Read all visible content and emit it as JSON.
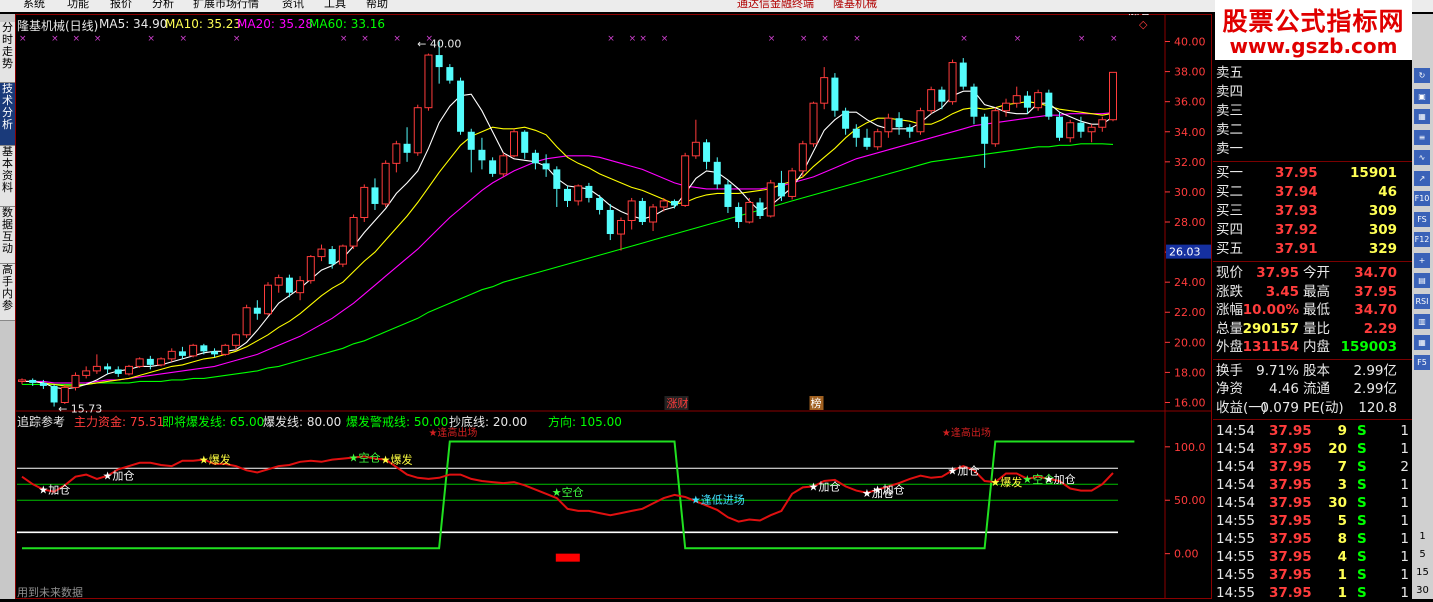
{
  "menu": [
    "系统",
    "功能",
    "报价",
    "分析",
    "扩展市场行情",
    "资讯",
    "工具",
    "帮助"
  ],
  "title_center": [
    "通达信金融终端",
    "隆基机械"
  ],
  "nav_tabs": [
    "分时走势",
    "技术分析",
    "基本资料",
    "数据互动",
    "高手内参"
  ],
  "header": {
    "name": "隆基机械(日线)",
    "ma5": "MA5: 34.90",
    "ma10": "MA10: 35.23",
    "ma20": "MA20: 35.28",
    "ma60": "MA60: 33.16"
  },
  "price_axis": [
    "40.00",
    "38.00",
    "36.00",
    "34.00",
    "32.00",
    "30.00",
    "28.00",
    "26.00",
    "24.00",
    "22.00",
    "20.00",
    "18.00",
    "16.00"
  ],
  "price_tag": "26.03",
  "price_labels": {
    "high": "40.00",
    "low": "15.73"
  },
  "event_labels": [
    "涨财",
    "榜"
  ],
  "indicator": {
    "name": "追踪参考",
    "zljj": "主力资金: 75.51",
    "jjbfx": "即将爆发线: 65.00",
    "bfx": "爆发线: 80.00",
    "bfjjx": "爆发警戒线: 50.00",
    "cdx": "抄底线: 20.00",
    "fx": "方向: 105.00",
    "axis": [
      "100.0",
      "50.00",
      "0.00"
    ],
    "signals": {
      "jiacang": "加仓",
      "baofa": "爆发",
      "kongcang": "空仓",
      "fengdi": "逢低进场",
      "fenggao": "逢高出场"
    }
  },
  "footer_text": "用到未来数据",
  "watermark": {
    "title": "股票公式指标网",
    "url": "www.gszb.com"
  },
  "order_book": {
    "sell": [
      {
        "label": "卖五",
        "price": "",
        "vol": ""
      },
      {
        "label": "卖四",
        "price": "",
        "vol": ""
      },
      {
        "label": "卖三",
        "price": "",
        "vol": ""
      },
      {
        "label": "卖二",
        "price": "",
        "vol": ""
      },
      {
        "label": "卖一",
        "price": "",
        "vol": ""
      }
    ],
    "buy": [
      {
        "label": "买一",
        "price": "37.95",
        "vol": "15901"
      },
      {
        "label": "买二",
        "price": "37.94",
        "vol": "46"
      },
      {
        "label": "买三",
        "price": "37.93",
        "vol": "309"
      },
      {
        "label": "买四",
        "price": "37.92",
        "vol": "309"
      },
      {
        "label": "买五",
        "price": "37.91",
        "vol": "329"
      }
    ]
  },
  "stats": [
    {
      "l1": "现价",
      "v1": "37.95",
      "l2": "今开",
      "v2": "34.70"
    },
    {
      "l1": "涨跌",
      "v1": "3.45",
      "l2": "最高",
      "v2": "37.95"
    },
    {
      "l1": "涨幅",
      "v1": "10.00%",
      "l2": "最低",
      "v2": "34.70"
    },
    {
      "l1": "总量",
      "v1": "290157",
      "l2": "量比",
      "v2": "2.29"
    },
    {
      "l1": "外盘",
      "v1": "131154",
      "l2": "内盘",
      "v2": "159003"
    }
  ],
  "stats2": [
    {
      "l1": "换手",
      "v1": "9.71%",
      "l2": "股本",
      "v2": "2.99亿"
    },
    {
      "l1": "净资",
      "v1": "4.46",
      "l2": "流通",
      "v2": "2.99亿"
    },
    {
      "l1": "收益(一)",
      "v1": "0.079",
      "l2": "PE(动)",
      "v2": "120.8"
    }
  ],
  "ticks": [
    {
      "time": "14:54",
      "price": "37.95",
      "vol": "9",
      "side": "S",
      "n": "1"
    },
    {
      "time": "14:54",
      "price": "37.95",
      "vol": "20",
      "side": "S",
      "n": "1"
    },
    {
      "time": "14:54",
      "price": "37.95",
      "vol": "7",
      "side": "S",
      "n": "2"
    },
    {
      "time": "14:54",
      "price": "37.95",
      "vol": "3",
      "side": "S",
      "n": "1"
    },
    {
      "time": "14:54",
      "price": "37.95",
      "vol": "30",
      "side": "S",
      "n": "1"
    },
    {
      "time": "14:55",
      "price": "37.95",
      "vol": "5",
      "side": "S",
      "n": "1"
    },
    {
      "time": "14:55",
      "price": "37.95",
      "vol": "8",
      "side": "S",
      "n": "1"
    },
    {
      "time": "14:55",
      "price": "37.95",
      "vol": "4",
      "side": "S",
      "n": "1"
    },
    {
      "time": "14:55",
      "price": "37.95",
      "vol": "1",
      "side": "S",
      "n": "1"
    },
    {
      "time": "14:55",
      "price": "37.95",
      "vol": "1",
      "side": "S",
      "n": "1"
    }
  ],
  "toolbar_icons": [
    {
      "name": "refresh-icon",
      "label": "↻"
    },
    {
      "name": "window-icon",
      "label": "▣"
    },
    {
      "name": "grid-icon",
      "label": "▦"
    },
    {
      "name": "list-icon",
      "label": "≡"
    },
    {
      "name": "ma-icon",
      "label": "∿"
    },
    {
      "name": "arrow-icon",
      "label": "↗"
    },
    {
      "name": "f10-icon",
      "label": "F10"
    },
    {
      "name": "f5-icon",
      "label": "FS"
    },
    {
      "name": "f12-icon",
      "label": "F12"
    },
    {
      "name": "cross-icon",
      "label": "+"
    },
    {
      "name": "chart-icon",
      "label": "▤"
    },
    {
      "name": "rsi-icon",
      "label": "RSI"
    },
    {
      "name": "f1-icon",
      "label": "▥"
    },
    {
      "name": "table-icon",
      "label": "▦"
    },
    {
      "name": "fs-icon",
      "label": "F5"
    }
  ],
  "side_numbers": [
    "1",
    "5",
    "15",
    "30"
  ],
  "colors": {
    "up": "#ff3c3c",
    "down": "#54fcfc",
    "ma5": "#ffffff",
    "ma10": "#ffff00",
    "ma20": "#ff00ff",
    "ma60": "#00ff00",
    "grid": "#8b0000"
  },
  "chart_data": {
    "type": "candlestick",
    "ylim": [
      15.5,
      40.5
    ],
    "candles": [
      [
        17.4,
        17.6,
        17.2,
        17.5
      ],
      [
        17.5,
        17.6,
        17.1,
        17.3
      ],
      [
        17.3,
        17.5,
        16.9,
        17.1
      ],
      [
        17.1,
        17.2,
        15.73,
        16.0
      ],
      [
        16.0,
        17.2,
        15.9,
        17.0
      ],
      [
        17.0,
        18.0,
        16.8,
        17.8
      ],
      [
        17.8,
        18.4,
        17.6,
        18.1
      ],
      [
        18.1,
        19.2,
        17.9,
        18.4
      ],
      [
        18.4,
        18.6,
        17.9,
        18.2
      ],
      [
        18.2,
        18.4,
        17.7,
        17.9
      ],
      [
        17.9,
        18.5,
        17.8,
        18.4
      ],
      [
        18.4,
        19.0,
        18.3,
        18.9
      ],
      [
        18.9,
        19.1,
        18.2,
        18.5
      ],
      [
        18.5,
        19.0,
        18.4,
        18.9
      ],
      [
        18.9,
        19.6,
        18.7,
        19.4
      ],
      [
        19.4,
        19.7,
        18.9,
        19.1
      ],
      [
        19.1,
        19.9,
        19.0,
        19.8
      ],
      [
        19.8,
        19.9,
        19.2,
        19.4
      ],
      [
        19.4,
        19.6,
        19.0,
        19.2
      ],
      [
        19.2,
        19.9,
        19.1,
        19.8
      ],
      [
        19.8,
        20.6,
        19.5,
        20.5
      ],
      [
        20.5,
        22.5,
        20.3,
        22.3
      ],
      [
        22.3,
        22.8,
        21.5,
        21.9
      ],
      [
        21.9,
        24.0,
        21.8,
        23.8
      ],
      [
        23.8,
        24.5,
        23.3,
        24.3
      ],
      [
        24.3,
        24.5,
        23.0,
        23.3
      ],
      [
        23.3,
        24.4,
        22.8,
        24.1
      ],
      [
        24.1,
        25.8,
        23.9,
        25.7
      ],
      [
        25.7,
        26.5,
        25.4,
        26.2
      ],
      [
        26.2,
        26.4,
        24.9,
        25.2
      ],
      [
        25.2,
        26.5,
        25.0,
        26.4
      ],
      [
        26.4,
        28.5,
        26.2,
        28.3
      ],
      [
        28.3,
        30.5,
        28.0,
        30.3
      ],
      [
        30.3,
        30.9,
        28.8,
        29.2
      ],
      [
        29.2,
        32.1,
        29.0,
        31.9
      ],
      [
        31.9,
        33.4,
        31.3,
        33.2
      ],
      [
        33.2,
        34.3,
        32.0,
        32.6
      ],
      [
        32.6,
        35.8,
        32.4,
        35.6
      ],
      [
        35.6,
        39.2,
        35.4,
        39.1
      ],
      [
        39.1,
        40.0,
        37.2,
        38.3
      ],
      [
        38.3,
        38.5,
        37.2,
        37.4
      ],
      [
        37.4,
        37.6,
        33.8,
        34.0
      ],
      [
        34.0,
        34.2,
        31.3,
        32.8
      ],
      [
        32.8,
        33.6,
        31.5,
        32.1
      ],
      [
        32.1,
        32.3,
        31.0,
        31.2
      ],
      [
        31.2,
        32.6,
        31.0,
        32.4
      ],
      [
        32.4,
        34.2,
        32.3,
        34.0
      ],
      [
        34.0,
        34.1,
        32.2,
        32.6
      ],
      [
        32.6,
        32.8,
        31.5,
        31.9
      ],
      [
        31.9,
        32.5,
        31.0,
        31.5
      ],
      [
        31.5,
        31.7,
        29.0,
        30.2
      ],
      [
        30.2,
        30.4,
        29.0,
        29.4
      ],
      [
        29.4,
        30.5,
        29.1,
        30.4
      ],
      [
        30.4,
        30.6,
        29.3,
        29.6
      ],
      [
        29.6,
        29.8,
        28.5,
        28.8
      ],
      [
        28.8,
        29.2,
        26.8,
        27.2
      ],
      [
        27.2,
        28.3,
        26.1,
        28.1
      ],
      [
        28.1,
        29.6,
        27.5,
        29.4
      ],
      [
        29.4,
        29.6,
        27.8,
        28.0
      ],
      [
        28.0,
        29.2,
        27.4,
        29.0
      ],
      [
        29.0,
        29.6,
        28.7,
        29.4
      ],
      [
        29.4,
        29.5,
        28.9,
        29.1
      ],
      [
        29.1,
        32.6,
        29.0,
        32.4
      ],
      [
        32.4,
        34.8,
        32.2,
        33.3
      ],
      [
        33.3,
        33.5,
        31.5,
        32.0
      ],
      [
        32.0,
        32.3,
        30.2,
        30.5
      ],
      [
        30.5,
        30.8,
        28.6,
        29.0
      ],
      [
        29.0,
        29.3,
        27.6,
        28.0
      ],
      [
        28.0,
        29.6,
        27.9,
        29.3
      ],
      [
        29.3,
        29.6,
        28.2,
        28.4
      ],
      [
        28.4,
        30.8,
        28.3,
        30.6
      ],
      [
        30.6,
        31.4,
        29.4,
        29.7
      ],
      [
        29.7,
        31.6,
        29.5,
        31.4
      ],
      [
        31.4,
        33.4,
        31.0,
        33.2
      ],
      [
        33.2,
        36.0,
        33.0,
        35.9
      ],
      [
        35.9,
        38.3,
        35.5,
        37.6
      ],
      [
        37.6,
        37.9,
        35.0,
        35.4
      ],
      [
        35.4,
        35.6,
        33.8,
        34.2
      ],
      [
        34.2,
        34.5,
        33.0,
        33.6
      ],
      [
        33.6,
        34.2,
        32.8,
        33.0
      ],
      [
        33.0,
        34.2,
        32.8,
        34.0
      ],
      [
        34.0,
        35.2,
        33.6,
        34.9
      ],
      [
        34.9,
        35.3,
        33.8,
        34.3
      ],
      [
        34.3,
        34.5,
        33.6,
        34.0
      ],
      [
        34.0,
        35.6,
        33.8,
        35.4
      ],
      [
        35.4,
        37.0,
        35.2,
        36.8
      ],
      [
        36.8,
        37.0,
        35.5,
        36.0
      ],
      [
        36.0,
        38.8,
        35.8,
        38.6
      ],
      [
        38.6,
        38.9,
        36.8,
        37.0
      ],
      [
        37.0,
        37.2,
        34.5,
        35.0
      ],
      [
        35.0,
        35.2,
        31.6,
        33.2
      ],
      [
        33.2,
        35.6,
        33.0,
        35.4
      ],
      [
        35.4,
        36.2,
        35.0,
        35.9
      ],
      [
        35.9,
        37.0,
        35.6,
        36.4
      ],
      [
        36.4,
        36.7,
        35.2,
        35.6
      ],
      [
        35.6,
        36.8,
        35.4,
        36.6
      ],
      [
        36.6,
        36.8,
        34.8,
        35.0
      ],
      [
        35.0,
        35.3,
        33.4,
        33.6
      ],
      [
        33.6,
        34.8,
        33.3,
        34.6
      ],
      [
        34.6,
        35.0,
        33.6,
        34.0
      ],
      [
        34.0,
        34.5,
        33.3,
        34.3
      ],
      [
        34.3,
        35.0,
        34.0,
        34.8
      ],
      [
        34.8,
        37.95,
        34.7,
        37.95
      ]
    ],
    "ma5": [
      17.4,
      17.4,
      17.3,
      17.0,
      16.9,
      17.0,
      17.2,
      17.5,
      17.9,
      18.1,
      18.2,
      18.4,
      18.4,
      18.5,
      18.7,
      18.9,
      19.1,
      19.3,
      19.4,
      19.4,
      19.5,
      20.0,
      20.8,
      21.7,
      22.6,
      23.1,
      23.6,
      24.2,
      24.8,
      25.1,
      25.6,
      26.4,
      27.3,
      28.1,
      28.9,
      29.9,
      30.6,
      31.4,
      32.9,
      34.6,
      35.7,
      36.4,
      36.5,
      35.4,
      34.0,
      32.6,
      32.2,
      32.1,
      32.0,
      31.7,
      30.9,
      30.4,
      30.3,
      30.2,
      29.7,
      29.1,
      28.7,
      28.4,
      28.2,
      28.4,
      28.8,
      29.0,
      29.9,
      30.9,
      31.4,
      31.3,
      30.8,
      30.2,
      29.4,
      28.7,
      29.1,
      29.7,
      30.3,
      31.3,
      32.7,
      34.1,
      34.8,
      35.3,
      35.3,
      34.8,
      34.4,
      34.2,
      34.2,
      34.2,
      34.6,
      35.2,
      35.6,
      36.4,
      36.7,
      36.7,
      35.8,
      35.6,
      35.3,
      35.2,
      35.2,
      35.9,
      35.9,
      35.3,
      35.0,
      34.7,
      34.5,
      34.5,
      35.0
    ],
    "ma10": [
      17.4,
      17.4,
      17.3,
      17.2,
      17.1,
      17.1,
      17.2,
      17.3,
      17.4,
      17.5,
      17.6,
      17.8,
      18.0,
      18.2,
      18.4,
      18.5,
      18.7,
      18.9,
      19.0,
      19.2,
      19.4,
      19.7,
      20.1,
      20.5,
      21.0,
      21.4,
      21.9,
      22.5,
      23.1,
      23.6,
      24.0,
      24.7,
      25.4,
      26.0,
      26.8,
      27.6,
      28.4,
      29.3,
      30.3,
      31.3,
      32.2,
      33.1,
      33.7,
      34.0,
      34.3,
      34.2,
      34.2,
      34.3,
      34.1,
      33.8,
      33.0,
      32.3,
      31.9,
      31.6,
      31.2,
      30.9,
      30.6,
      30.3,
      30.1,
      29.8,
      29.5,
      29.2,
      29.3,
      29.6,
      29.8,
      29.9,
      29.9,
      29.9,
      30.0,
      30.1,
      30.2,
      30.5,
      30.7,
      31.0,
      31.7,
      32.3,
      32.9,
      33.6,
      34.2,
      34.6,
      34.9,
      34.9,
      34.8,
      34.7,
      34.5,
      34.5,
      34.8,
      35.2,
      35.5,
      35.6,
      35.5,
      35.6,
      35.8,
      35.9,
      36.0,
      35.9,
      35.7,
      35.5,
      35.4,
      35.3,
      35.2,
      35.1,
      35.23
    ],
    "ma20": [
      17.4,
      17.4,
      17.4,
      17.3,
      17.3,
      17.3,
      17.3,
      17.4,
      17.5,
      17.5,
      17.6,
      17.7,
      17.8,
      17.9,
      18.0,
      18.1,
      18.2,
      18.3,
      18.4,
      18.6,
      18.8,
      19.0,
      19.2,
      19.5,
      19.8,
      20.1,
      20.4,
      20.8,
      21.2,
      21.6,
      22.1,
      22.6,
      23.2,
      23.8,
      24.4,
      25.0,
      25.6,
      26.2,
      26.9,
      27.6,
      28.3,
      28.9,
      29.5,
      30.1,
      30.6,
      31.0,
      31.4,
      31.7,
      32.0,
      32.2,
      32.3,
      32.4,
      32.4,
      32.4,
      32.3,
      32.1,
      31.9,
      31.7,
      31.5,
      31.2,
      30.9,
      30.6,
      30.4,
      30.3,
      30.2,
      30.2,
      30.2,
      30.2,
      30.2,
      30.2,
      30.3,
      30.4,
      30.6,
      30.8,
      31.0,
      31.3,
      31.6,
      31.9,
      32.2,
      32.4,
      32.6,
      32.8,
      33.0,
      33.2,
      33.4,
      33.6,
      33.8,
      34.0,
      34.2,
      34.4,
      34.5,
      34.6,
      34.7,
      34.8,
      34.9,
      35.0,
      35.1,
      35.1,
      35.2,
      35.2,
      35.2,
      35.2,
      35.28
    ],
    "ma60": [
      17.2,
      17.2,
      17.2,
      17.2,
      17.2,
      17.2,
      17.2,
      17.3,
      17.3,
      17.3,
      17.3,
      17.4,
      17.4,
      17.4,
      17.5,
      17.5,
      17.6,
      17.6,
      17.7,
      17.8,
      17.9,
      18.0,
      18.1,
      18.3,
      18.4,
      18.6,
      18.8,
      19.0,
      19.2,
      19.4,
      19.6,
      19.9,
      20.1,
      20.4,
      20.7,
      21.0,
      21.3,
      21.6,
      22.0,
      22.3,
      22.6,
      22.9,
      23.2,
      23.5,
      23.7,
      24.0,
      24.2,
      24.4,
      24.6,
      24.8,
      25.0,
      25.2,
      25.4,
      25.6,
      25.8,
      26.0,
      26.2,
      26.4,
      26.6,
      26.8,
      27.0,
      27.2,
      27.4,
      27.6,
      27.8,
      28.0,
      28.2,
      28.4,
      28.6,
      28.8,
      29.0,
      29.2,
      29.4,
      29.6,
      29.8,
      30.0,
      30.2,
      30.4,
      30.6,
      30.8,
      31.0,
      31.2,
      31.4,
      31.6,
      31.8,
      32.0,
      32.1,
      32.2,
      32.3,
      32.4,
      32.5,
      32.6,
      32.7,
      32.8,
      32.9,
      33.0,
      33.0,
      33.1,
      33.1,
      33.2,
      33.2,
      33.2,
      33.16
    ],
    "tracker": [
      72,
      65,
      60,
      58,
      64,
      72,
      74,
      70,
      73,
      79,
      82,
      85,
      85,
      83,
      82,
      87,
      87,
      88,
      84,
      84,
      82,
      78,
      76,
      79,
      82,
      83,
      86,
      87,
      86,
      88,
      89,
      90,
      91,
      89,
      88,
      81,
      74,
      71,
      70,
      71,
      74,
      74,
      70,
      68,
      67,
      66,
      67,
      64,
      60,
      56,
      52,
      42,
      40,
      40,
      38,
      36,
      38,
      40,
      42,
      47,
      52,
      55,
      53,
      49,
      45,
      41,
      34,
      30,
      32,
      31,
      36,
      40,
      56,
      62,
      63,
      68,
      69,
      63,
      59,
      57,
      60,
      63,
      66,
      70,
      73,
      71,
      72,
      78,
      82,
      78,
      68,
      67,
      75,
      75,
      70,
      72,
      70,
      68,
      61,
      59,
      59,
      65,
      75.51
    ],
    "direction": [
      5,
      5,
      5,
      5,
      5,
      5,
      5,
      5,
      5,
      5,
      5,
      5,
      5,
      5,
      5,
      5,
      5,
      5,
      5,
      5,
      5,
      5,
      5,
      5,
      5,
      5,
      5,
      5,
      5,
      5,
      5,
      5,
      5,
      5,
      5,
      5,
      5,
      5,
      5,
      5,
      105,
      105,
      105,
      105,
      105,
      105,
      105,
      105,
      105,
      105,
      105,
      105,
      105,
      105,
      105,
      105,
      105,
      105,
      105,
      105,
      105,
      105,
      5,
      5,
      5,
      5,
      5,
      5,
      5,
      5,
      5,
      5,
      5,
      5,
      5,
      5,
      5,
      5,
      5,
      5,
      5,
      5,
      5,
      5,
      5,
      5,
      5,
      5,
      5,
      5,
      5,
      105,
      105,
      105,
      105,
      105,
      105,
      105,
      105,
      105,
      105,
      105,
      105,
      105,
      105
    ],
    "indicator_ylim": [
      -5,
      112
    ],
    "hlines": [
      80,
      65,
      50,
      20
    ]
  }
}
